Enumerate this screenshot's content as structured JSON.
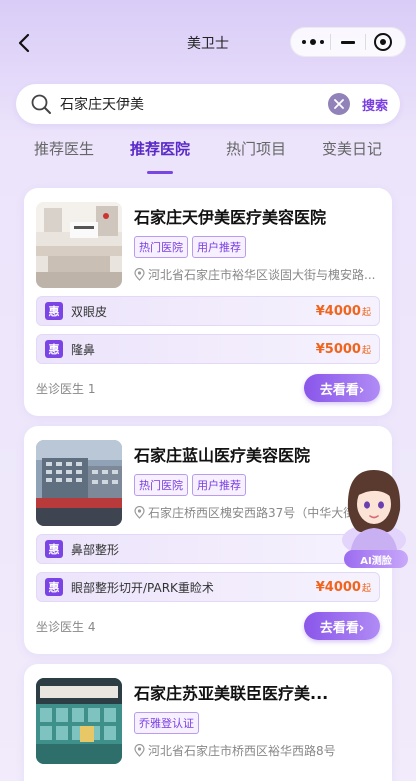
{
  "nav": {
    "title": "美卫士"
  },
  "search": {
    "value": "石家庄天伊美",
    "button_label": "搜索"
  },
  "tabs": [
    {
      "label": "推荐医生",
      "active": false
    },
    {
      "label": "推荐医院",
      "active": true
    },
    {
      "label": "热门项目",
      "active": false
    },
    {
      "label": "变美日记",
      "active": false
    }
  ],
  "hospitals": [
    {
      "name": "石家庄天伊美医疗美容医院",
      "tags": [
        "热门医院",
        "用户推荐"
      ],
      "address": "河北省石家庄市裕华区谈固大街与槐安路...",
      "services": [
        {
          "badge": "惠",
          "name": "双眼皮",
          "price": "¥4000",
          "unit": "起"
        },
        {
          "badge": "惠",
          "name": "隆鼻",
          "price": "¥5000",
          "unit": "起"
        }
      ],
      "doctors": "坐诊医生 1",
      "button": "去看看›"
    },
    {
      "name": "石家庄蓝山医疗美容医院",
      "tags": [
        "热门医院",
        "用户推荐"
      ],
      "address": "石家庄桥西区槐安西路37号（中华大街...",
      "services": [
        {
          "badge": "惠",
          "name": "鼻部整形",
          "price": "¥",
          "unit": ""
        },
        {
          "badge": "惠",
          "name": "眼部整形切开/PARK重睑术",
          "price": "¥4000",
          "unit": "起"
        }
      ],
      "doctors": "坐诊医生 4",
      "button": "去看看›"
    },
    {
      "name": "石家庄苏亚美联臣医疗美...",
      "tags": [
        "乔雅登认证"
      ],
      "address": "河北省石家庄市桥西区裕华西路8号"
    }
  ],
  "ai": {
    "label": "AI测脸"
  },
  "colors": {
    "accent": "#7b45e6",
    "price": "#f0641e",
    "background": "#ece4fb"
  }
}
